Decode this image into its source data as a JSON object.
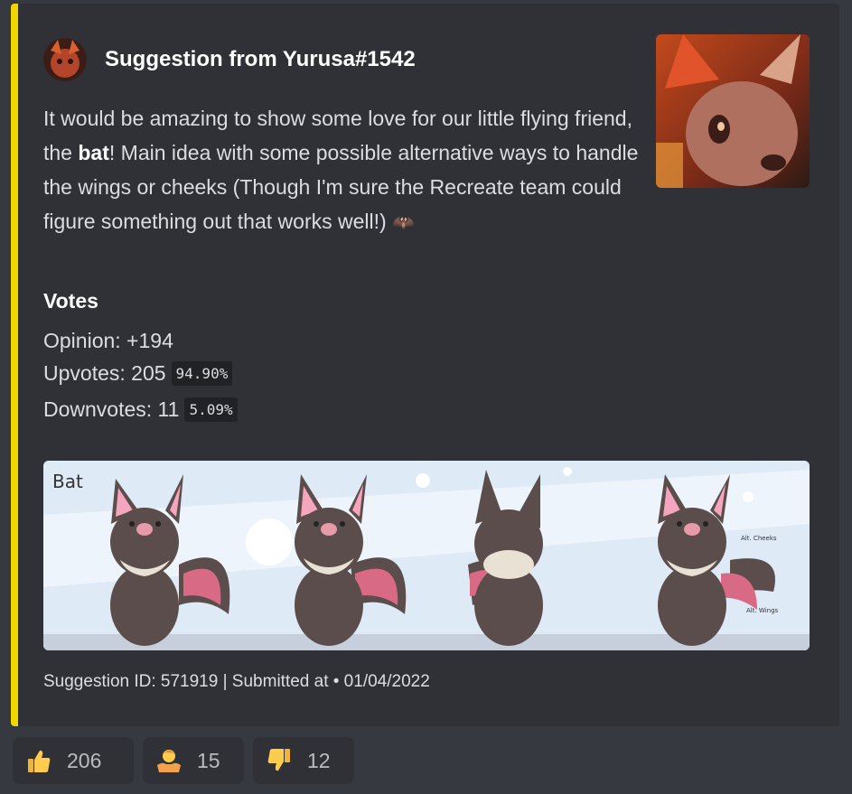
{
  "embed": {
    "accent_color": "#f1d600",
    "author": "Suggestion from Yurusa#1542",
    "description": {
      "part1": "It would be amazing to show some love for our little flying friend, the ",
      "bold": "bat",
      "part2": "! Main idea with some possible alternative ways to handle the wings or cheeks (Though I'm sure the Recreate team could figure something out that works well!) ",
      "emoji": "🦇"
    },
    "votes": {
      "title": "Votes",
      "opinion": "Opinion: +194",
      "upvotes": "Upvotes: 205",
      "upvotes_pct": "94.90%",
      "downvotes": "Downvotes: 11",
      "downvotes_pct": "5.09%"
    },
    "image": {
      "label": "Bat",
      "annotation_1": "Alt. Cheeks",
      "annotation_2": "Alt. Wings"
    },
    "footer": "Suggestion ID: 571919 | Submitted at • 01/04/2022"
  },
  "reactions": [
    {
      "emoji": "thumbs-up-icon",
      "count": "206"
    },
    {
      "emoji": "person-shrugging-icon",
      "count": "15"
    },
    {
      "emoji": "thumbs-down-icon",
      "count": "12"
    }
  ]
}
